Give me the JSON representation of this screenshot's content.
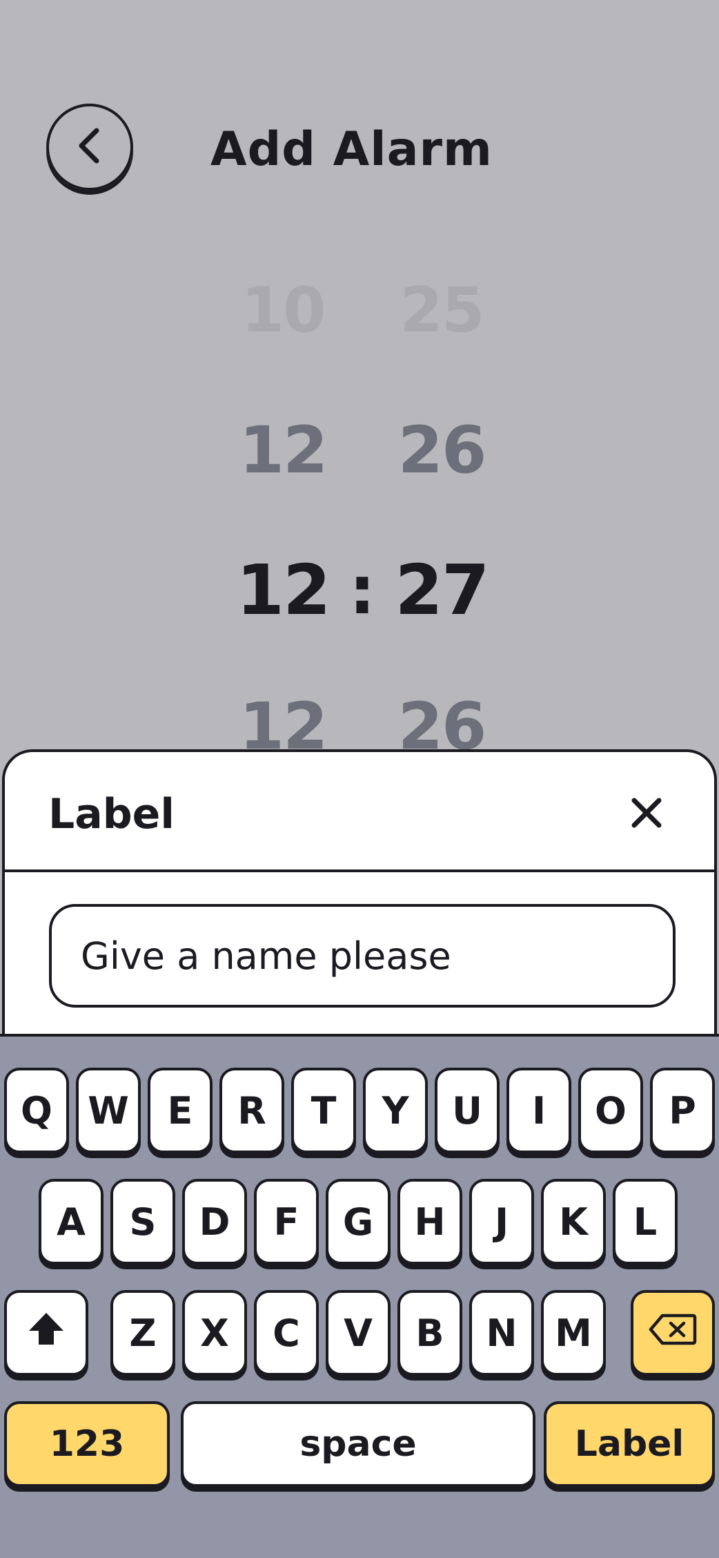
{
  "header": {
    "title": "Add Alarm"
  },
  "picker": {
    "rows": [
      {
        "hour": "10",
        "minute": "25"
      },
      {
        "hour": "12",
        "minute": "26"
      },
      {
        "hour": "12",
        "minute": "27"
      },
      {
        "hour": "12",
        "minute": "26"
      }
    ],
    "separator": ":"
  },
  "label_sheet": {
    "title": "Label",
    "input_placeholder": "Give a name please",
    "input_value": ""
  },
  "keyboard": {
    "row1": [
      "Q",
      "W",
      "E",
      "R",
      "T",
      "Y",
      "U",
      "I",
      "O",
      "P"
    ],
    "row2": [
      "A",
      "S",
      "D",
      "F",
      "G",
      "H",
      "J",
      "K",
      "L"
    ],
    "row3": [
      "Z",
      "X",
      "C",
      "V",
      "B",
      "N",
      "M"
    ],
    "numbers_key": "123",
    "space_key": "space",
    "return_key": "Label"
  },
  "colors": {
    "background": "#b8b8bc",
    "keyboard_bg": "#9296a7",
    "accent_key": "#ffd76b",
    "ink": "#1b1a20"
  }
}
